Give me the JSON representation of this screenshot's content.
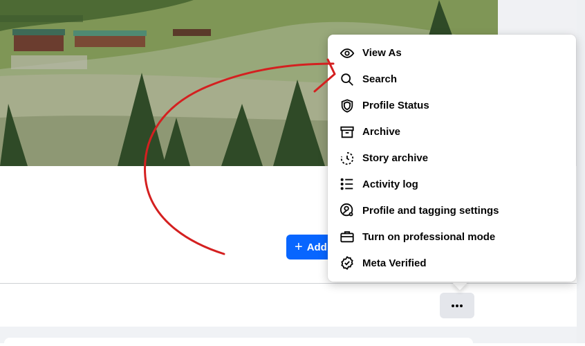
{
  "add_button": {
    "label": "Add"
  },
  "menu": {
    "items": [
      {
        "label": "View As",
        "icon": "eye-icon"
      },
      {
        "label": "Search",
        "icon": "search-icon"
      },
      {
        "label": "Profile Status",
        "icon": "shield-icon"
      },
      {
        "label": "Archive",
        "icon": "archive-box-icon"
      },
      {
        "label": "Story archive",
        "icon": "story-archive-icon"
      },
      {
        "label": "Activity log",
        "icon": "list-icon"
      },
      {
        "label": "Profile and tagging settings",
        "icon": "profile-settings-icon"
      },
      {
        "label": "Turn on professional mode",
        "icon": "briefcase-icon"
      },
      {
        "label": "Meta Verified",
        "icon": "verified-badge-icon"
      }
    ]
  },
  "colors": {
    "primary": "#0866ff",
    "annotation": "#d42020",
    "menu_text": "#050505"
  }
}
